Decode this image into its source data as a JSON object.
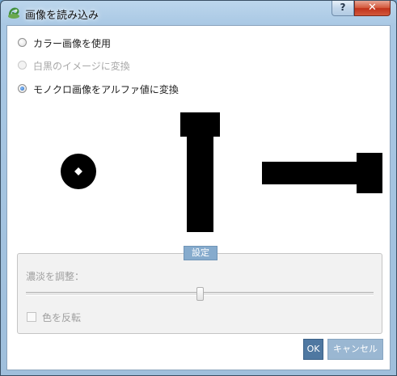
{
  "window": {
    "title": "画像を読み込み"
  },
  "titlebar": {
    "help_label": "?",
    "close_label": "✕"
  },
  "options": {
    "color": {
      "label": "カラー画像を使用",
      "selected": false,
      "enabled": true
    },
    "white_black": {
      "label": "白黒のイメージに変換",
      "selected": false,
      "enabled": false
    },
    "mono_alpha": {
      "label": "モノクロ画像をアルファ値に変換",
      "selected": true,
      "enabled": true
    }
  },
  "settings": {
    "tab_label": "設定",
    "adjust_label": "濃淡を調整：",
    "slider_value": 0.5,
    "invert_label": "色を反転",
    "invert_checked": false
  },
  "buttons": {
    "ok_label": "OK",
    "cancel_label": "キャンセル"
  },
  "colors": {
    "accent": "#4f78a1",
    "tab": "#86abcd",
    "close": "#c1321b"
  }
}
